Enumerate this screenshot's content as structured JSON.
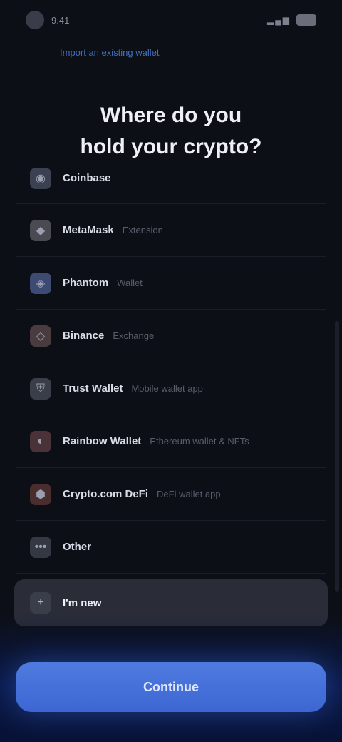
{
  "status_bar": {
    "time": "9:41",
    "icons": "▂▄▆",
    "battery": ""
  },
  "header": {
    "link_text": "Import an existing wallet"
  },
  "title": {
    "line1": "Where do you",
    "line2": "hold your crypto?"
  },
  "options": [
    {
      "label": "Coinbase",
      "sub": "",
      "icon": "coin-icon",
      "icon_color": "#3b4150",
      "glyph": "◉"
    },
    {
      "label": "MetaMask",
      "sub": "Extension",
      "icon": "fox-icon",
      "icon_color": "#4a4a52",
      "glyph": "◆"
    },
    {
      "label": "Phantom",
      "sub": "Wallet",
      "icon": "ghost-icon",
      "icon_color": "#3d4a73",
      "glyph": "◈"
    },
    {
      "label": "Binance",
      "sub": "Exchange",
      "icon": "diamond-icon",
      "icon_color": "#4a3b3e",
      "glyph": "◇"
    },
    {
      "label": "Trust Wallet",
      "sub": "Mobile wallet app",
      "icon": "shield-icon",
      "icon_color": "#3a3e48",
      "glyph": "⛨"
    },
    {
      "label": "Rainbow Wallet",
      "sub": "Ethereum wallet & NFTs",
      "icon": "rainbow-icon",
      "icon_color": "#4a3338",
      "glyph": "◐"
    },
    {
      "label": "Crypto.com DeFi",
      "sub": "DeFi wallet app",
      "icon": "hex-icon",
      "icon_color": "#4a2e2e",
      "glyph": "⬢"
    },
    {
      "label": "Other",
      "sub": "",
      "icon": "dots-icon",
      "icon_color": "#343843",
      "glyph": "•••"
    }
  ],
  "selected": {
    "label": "I'm new",
    "icon": "plus-icon",
    "glyph": "+"
  },
  "continue_label": "Continue",
  "colors": {
    "accent": "#4f7be0",
    "background": "#0d0f16",
    "selected_bg": "#2a2d38"
  }
}
